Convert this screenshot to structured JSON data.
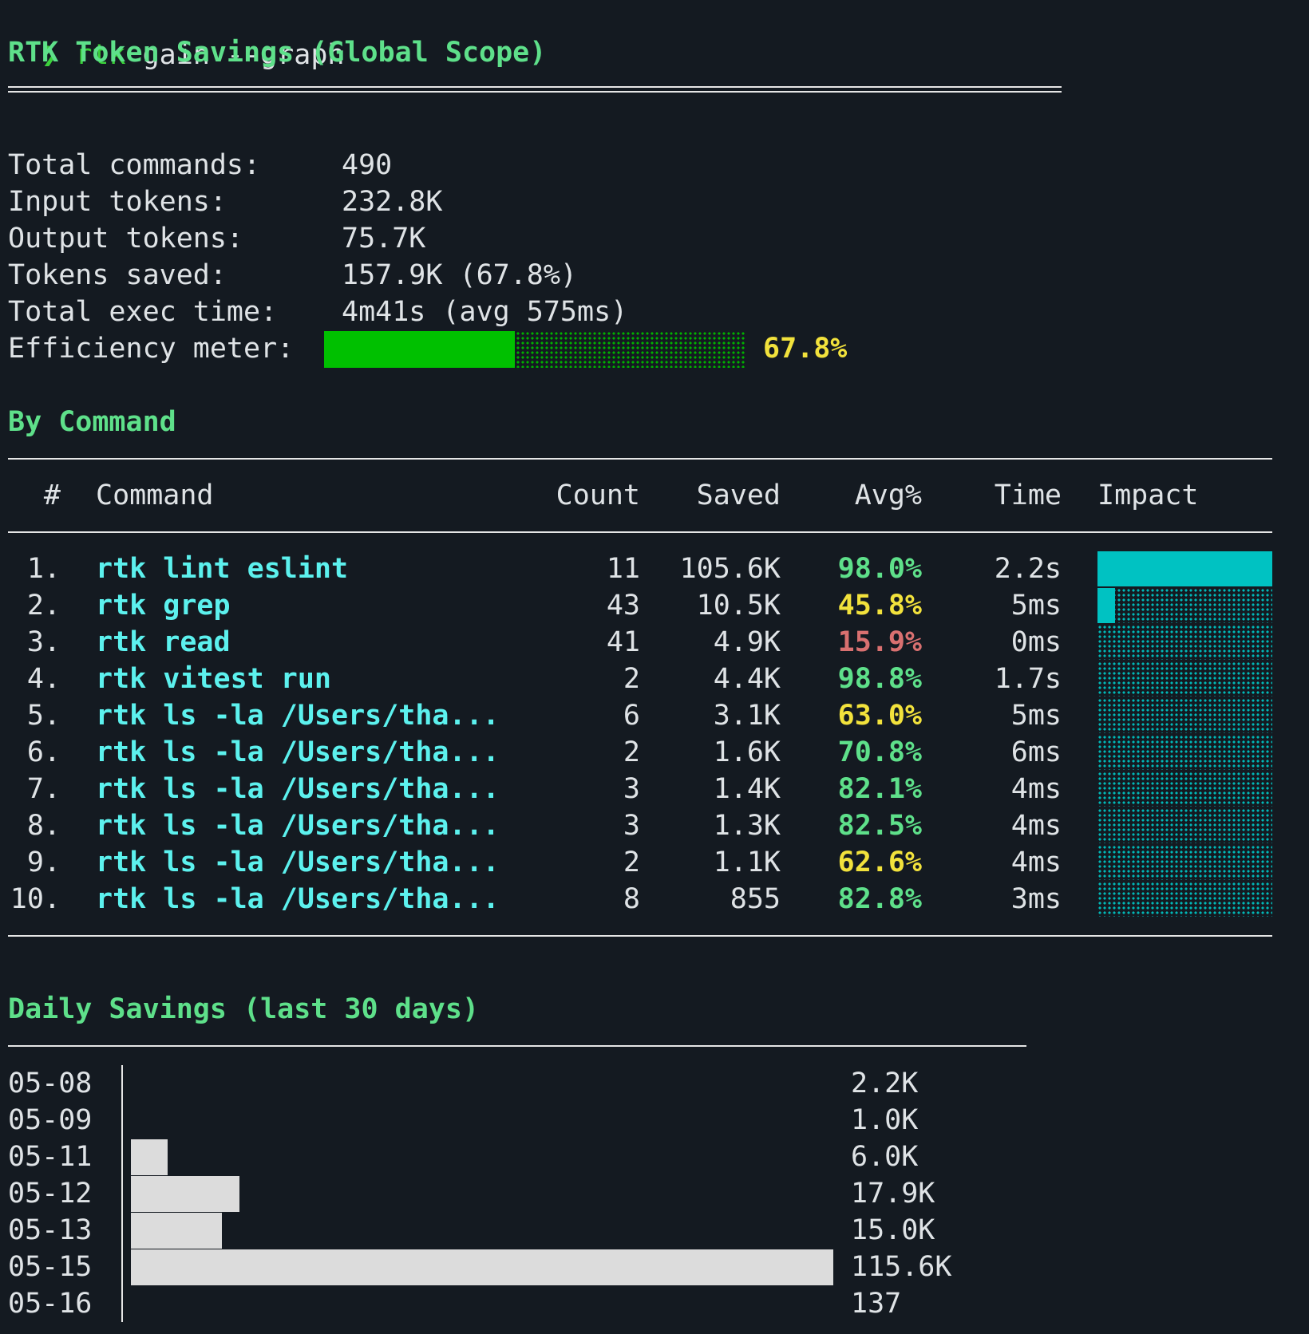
{
  "colors": {
    "background": "#141a21",
    "text": "#dfe3e6",
    "prompt": "#3bd13b",
    "heading": "#5ee08a",
    "command": "#5cf1ee",
    "pct_green": "#5ee08a",
    "pct_yellow": "#f2e23c",
    "pct_red": "#d97070",
    "meter_fill": "#00c000",
    "impact_fill": "#00c2c2",
    "daily_bar": "#dcdcdc"
  },
  "prompt": {
    "symbol": "❯",
    "cmd": "rtk",
    "args": "gain --graph"
  },
  "title": "RTK Token Savings (Global Scope)",
  "summary": [
    {
      "label": "Total commands:",
      "value": "490"
    },
    {
      "label": "Input tokens:",
      "value": "232.8K"
    },
    {
      "label": "Output tokens:",
      "value": "75.7K"
    },
    {
      "label": "Tokens saved:",
      "value": "157.9K (67.8%)"
    },
    {
      "label": "Total exec time:",
      "value": "4m41s (avg 575ms)"
    }
  ],
  "efficiency": {
    "label": "Efficiency meter:",
    "value_text": "67.8%",
    "fraction": 0.678
  },
  "by_command": {
    "heading": "By Command",
    "headers": {
      "num": "#",
      "command": "Command",
      "count": "Count",
      "saved": "Saved",
      "avg": "Avg%",
      "time": "Time",
      "impact": "Impact"
    },
    "rows": [
      {
        "num": "1.",
        "command": "rtk lint eslint",
        "count": "11",
        "saved": "105.6K",
        "avg": "98.0%",
        "avg_color": "green",
        "time": "2.2s",
        "impact": 1.0
      },
      {
        "num": "2.",
        "command": "rtk grep",
        "count": "43",
        "saved": "10.5K",
        "avg": "45.8%",
        "avg_color": "yellow",
        "time": "5ms",
        "impact": 0.1
      },
      {
        "num": "3.",
        "command": "rtk read",
        "count": "41",
        "saved": "4.9K",
        "avg": "15.9%",
        "avg_color": "red",
        "time": "0ms",
        "impact": 0.0
      },
      {
        "num": "4.",
        "command": "rtk vitest run",
        "count": "2",
        "saved": "4.4K",
        "avg": "98.8%",
        "avg_color": "green",
        "time": "1.7s",
        "impact": 0.0
      },
      {
        "num": "5.",
        "command": "rtk ls -la /Users/tha...",
        "count": "6",
        "saved": "3.1K",
        "avg": "63.0%",
        "avg_color": "yellow",
        "time": "5ms",
        "impact": 0.0
      },
      {
        "num": "6.",
        "command": "rtk ls -la /Users/tha...",
        "count": "2",
        "saved": "1.6K",
        "avg": "70.8%",
        "avg_color": "green",
        "time": "6ms",
        "impact": 0.0
      },
      {
        "num": "7.",
        "command": "rtk ls -la /Users/tha...",
        "count": "3",
        "saved": "1.4K",
        "avg": "82.1%",
        "avg_color": "green",
        "time": "4ms",
        "impact": 0.0
      },
      {
        "num": "8.",
        "command": "rtk ls -la /Users/tha...",
        "count": "3",
        "saved": "1.3K",
        "avg": "82.5%",
        "avg_color": "green",
        "time": "4ms",
        "impact": 0.0
      },
      {
        "num": "9.",
        "command": "rtk ls -la /Users/tha...",
        "count": "2",
        "saved": "1.1K",
        "avg": "62.6%",
        "avg_color": "yellow",
        "time": "4ms",
        "impact": 0.0
      },
      {
        "num": "10.",
        "command": "rtk ls -la /Users/tha...",
        "count": "8",
        "saved": "855",
        "avg": "82.8%",
        "avg_color": "green",
        "time": "3ms",
        "impact": 0.0
      }
    ]
  },
  "daily": {
    "heading": "Daily Savings (last 30 days)",
    "rows": [
      {
        "date": "05-08",
        "label": "2.2K",
        "value": 2200
      },
      {
        "date": "05-09",
        "label": "1.0K",
        "value": 1000
      },
      {
        "date": "05-11",
        "label": "6.0K",
        "value": 6000
      },
      {
        "date": "05-12",
        "label": "17.9K",
        "value": 17900
      },
      {
        "date": "05-13",
        "label": "15.0K",
        "value": 15000
      },
      {
        "date": "05-15",
        "label": "115.6K",
        "value": 115600
      },
      {
        "date": "05-16",
        "label": "137",
        "value": 137
      }
    ]
  }
}
